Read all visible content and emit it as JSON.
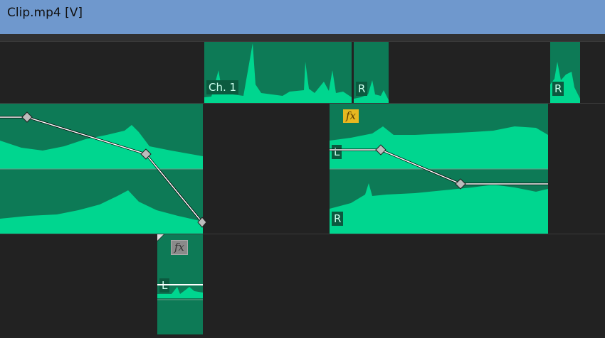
{
  "window": {
    "title": "Clip.mp4 [V]"
  },
  "colors": {
    "titlebar": "#6f98cd",
    "clip_bg": "#0d7a56",
    "waveform": "#00d68f",
    "fx_active": "#e8b820",
    "fx_inactive": "#8a8a8a",
    "track_bg": "#222222"
  },
  "tracks": [
    {
      "clips": [
        {
          "channel_labels": [
            "Ch. 1"
          ],
          "fx": null
        },
        {
          "channel_labels": [
            "R"
          ],
          "fx": null
        },
        {
          "channel_labels": [
            "R"
          ],
          "fx": null
        }
      ]
    },
    {
      "clips": [
        {
          "channel_labels": [],
          "fx": null,
          "keyframes": 3
        },
        {
          "channel_labels": [
            "L",
            "R"
          ],
          "fx": "fx",
          "fx_state": "active",
          "keyframes": 2
        }
      ]
    },
    {
      "clips": [
        {
          "channel_labels": [
            "L"
          ],
          "fx": "fx",
          "fx_state": "inactive"
        }
      ]
    }
  ],
  "labels": {
    "ch1": "Ch. 1",
    "r": "R",
    "l": "L",
    "fx": "fx"
  },
  "icons": [
    "keyframe-diamond-icon",
    "fx-badge-icon",
    "clip-start-marker-icon"
  ]
}
